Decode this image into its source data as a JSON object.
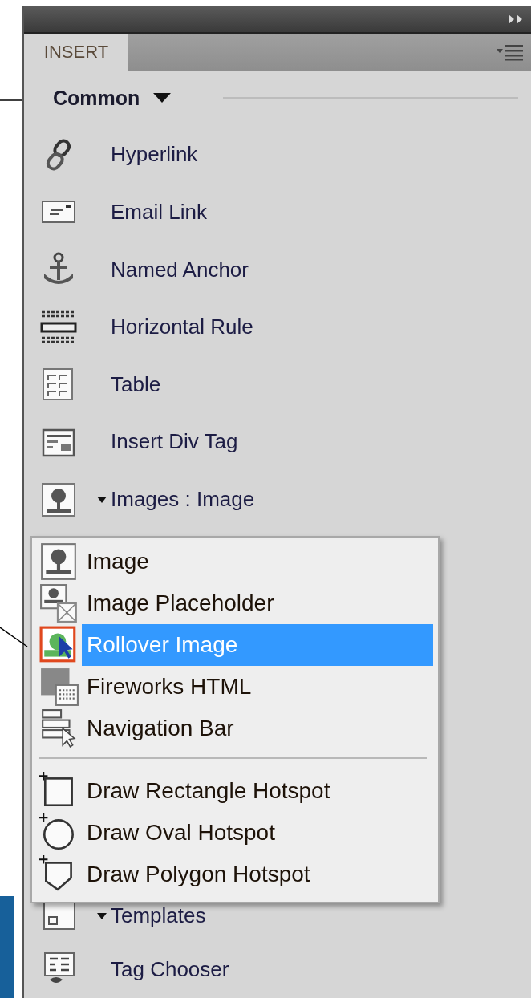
{
  "panel": {
    "tab": {
      "label": "INSERT",
      "selected": true
    },
    "category": {
      "label": "Common"
    },
    "items": [
      {
        "label": "Hyperlink",
        "kind": "button"
      },
      {
        "label": "Email Link",
        "kind": "button"
      },
      {
        "label": "Named Anchor",
        "kind": "button"
      },
      {
        "label": "Horizontal Rule",
        "kind": "button"
      },
      {
        "label": "Table",
        "kind": "button"
      },
      {
        "label": "Insert Div Tag",
        "kind": "button"
      },
      {
        "label": "Images : Image",
        "kind": "dropdown"
      },
      {
        "label": "Templates",
        "kind": "dropdown"
      },
      {
        "label": "Tag Chooser",
        "kind": "button"
      }
    ]
  },
  "menu": {
    "groups": [
      [
        {
          "label": "Image",
          "selected": false
        },
        {
          "label": "Image Placeholder",
          "selected": false
        },
        {
          "label": "Rollover Image",
          "selected": true
        },
        {
          "label": "Fireworks HTML",
          "selected": false
        },
        {
          "label": "Navigation Bar",
          "selected": false
        }
      ],
      [
        {
          "label": "Draw Rectangle Hotspot",
          "selected": false
        },
        {
          "label": "Draw Oval Hotspot",
          "selected": false
        },
        {
          "label": "Draw Polygon Hotspot",
          "selected": false
        }
      ]
    ]
  }
}
